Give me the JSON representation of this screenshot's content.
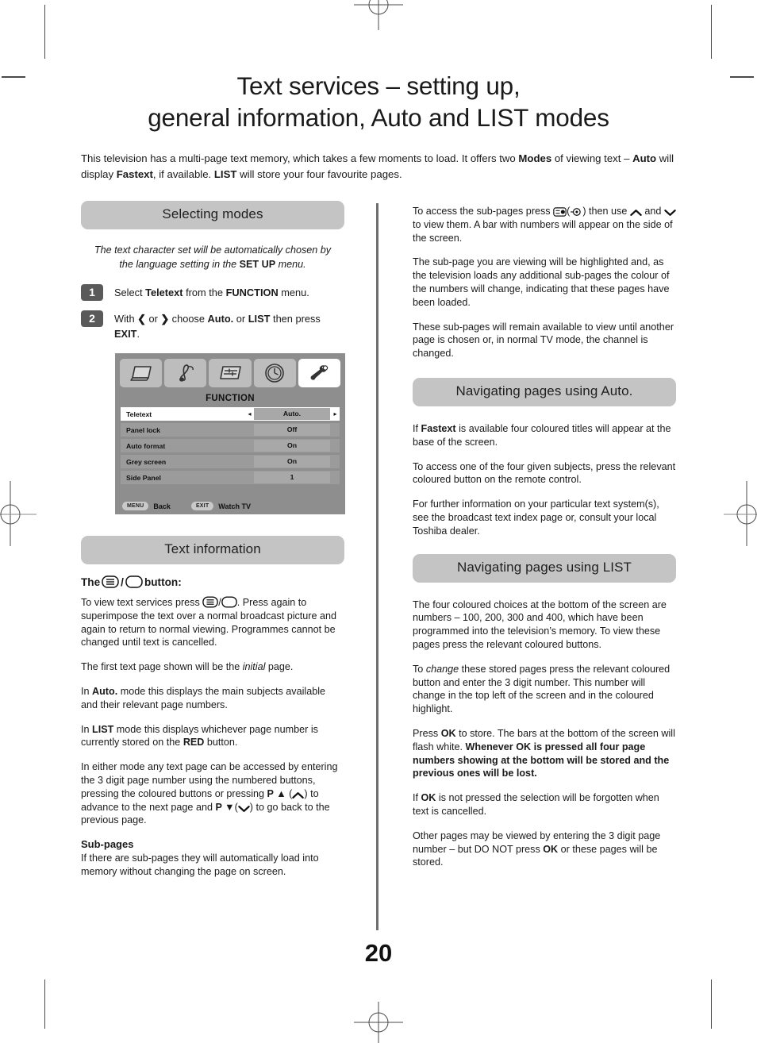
{
  "page": {
    "number": "20",
    "title_line1": "Text services – setting up,",
    "title_line2": "general information, Auto and LIST modes",
    "intro_html": "This television has a multi-page text memory, which takes a few moments to load. It offers two <b>Modes</b> of viewing text – <b>Auto</b> will display <b>Fastext</b>, if available. <b>LIST</b> will store your four favourite pages."
  },
  "left_column": {
    "section1": {
      "heading": "Selecting modes",
      "note_html": "The text character set will be automatically chosen by the language setting in the <b>SET UP</b> menu.",
      "steps": [
        {
          "number": "1",
          "text_html": "Select <b>Teletext</b> from the <b>FUNCTION</b> menu."
        },
        {
          "number": "2",
          "text_html": "With <b>❮</b> or <b>❯</b> choose <b>Auto.</b> or <b>LIST</b> then press <b>EXIT</b>."
        }
      ]
    },
    "tv_menu": {
      "icons": [
        {
          "name": "picture-icon",
          "selected": false
        },
        {
          "name": "sound-note-icon",
          "selected": false
        },
        {
          "name": "feature-sliders-icon",
          "selected": false
        },
        {
          "name": "clock-icon",
          "selected": false
        },
        {
          "name": "wrench-setup-icon",
          "selected": true
        }
      ],
      "title": "FUNCTION",
      "rows": [
        {
          "label": "Teletext",
          "value": "Auto.",
          "active": true,
          "arrows": true
        },
        {
          "label": "Panel lock",
          "value": "Off",
          "active": false,
          "arrows": false
        },
        {
          "label": "Auto format",
          "value": "On",
          "active": false,
          "arrows": false
        },
        {
          "label": "Grey screen",
          "value": "On",
          "active": false,
          "arrows": false
        },
        {
          "label": "Side Panel",
          "value": "1",
          "active": false,
          "arrows": false
        }
      ],
      "footer": [
        {
          "key": "MENU",
          "label": "Back"
        },
        {
          "key": "EXIT",
          "label": "Watch TV"
        }
      ]
    },
    "section2": {
      "heading": "Text information",
      "button_heading_prefix": "The",
      "button_heading_suffix": "button:",
      "paragraphs": [
        "To view text services press <ICON_TEXT>/<ICON_BLANK>. Press again to superimpose the text over a normal broadcast picture and again to return to normal viewing. Programmes cannot be changed until text is cancelled.",
        "The first text page shown will be the <i>initial</i> page.",
        "In <b>Auto.</b> mode this displays the main subjects available and their relevant page numbers.",
        "In <b>LIST</b> mode this displays whichever page number is currently stored on the <b>RED</b> button.",
        "In either mode any text page can be accessed by entering the 3 digit page number using the numbered buttons, pressing the coloured buttons or pressing <b>P ▲</b> (<ICON_UP>) to advance to the next page and <b>P ▼</b>(<ICON_DOWN>) to go back to the previous page."
      ],
      "subpages_heading": "Sub-pages",
      "subpages_text": "If there are sub-pages they will automatically load into memory without changing the page on screen."
    }
  },
  "right_column": {
    "intro_paragraphs": [
      "To access the sub-pages press <ICON_SUBPAGE>(<ICON_REVEAL>) then use <ICON_UP> and <ICON_DOWN> to view them. A bar with numbers will appear on the side of the screen.",
      "The sub-page you are viewing will be highlighted and, as the television loads any additional sub-pages the colour of the numbers will change, indicating that these pages have been loaded.",
      "These sub-pages will remain available to view until another page is chosen or, in normal TV mode, the channel is changed."
    ],
    "section_auto": {
      "heading": "Navigating pages using Auto.",
      "paragraphs": [
        "If <b>Fastext</b> is available four coloured titles will appear at the base of the screen.",
        "To access one of the four given subjects, press the relevant coloured button on the remote control.",
        "For further information on your particular text system(s), see the broadcast text index page or, consult your local Toshiba dealer."
      ]
    },
    "section_list": {
      "heading": "Navigating pages using LIST",
      "paragraphs": [
        "The four coloured choices at the bottom of the screen are numbers – 100, 200, 300 and 400, which have been programmed into the television’s memory. To view these pages press the relevant coloured buttons.",
        "To <i>change</i> these stored pages press the relevant coloured button and enter the 3 digit number. This number will change in the top left of the screen and in the coloured highlight.",
        "Press <b>OK</b> to store. The bars at the bottom of the screen will flash white. <b>Whenever OK is pressed all four page numbers showing at the bottom will be stored and the previous ones will be lost.</b>",
        "If <b>OK</b> is not pressed the selection will be forgotten when text is cancelled.",
        "Other pages may be viewed by entering the 3 digit page number – but DO NOT press <b>OK</b> or these pages will be stored."
      ]
    }
  },
  "colors": {
    "heading_pill": "#c4c4c4",
    "step_badge": "#5a5a5a",
    "tv_menu_bg": "#8e8e8e",
    "divider": "#6e6e6e"
  }
}
